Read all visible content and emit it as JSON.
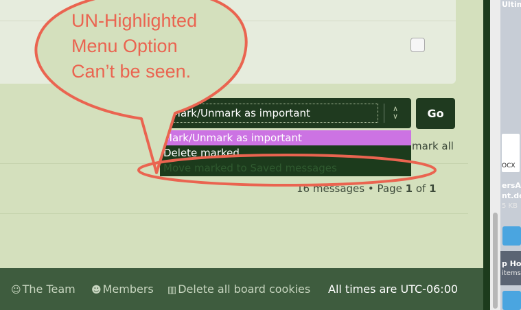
{
  "callout": {
    "line1": "UN-Highlighted",
    "line2": "Menu Option",
    "line3": "Can’t be seen.",
    "color": "#ea6450"
  },
  "actions": {
    "select_value": "Mark/Unmark as important",
    "go_label": "Go",
    "options": [
      "Mark/Unmark as important",
      "Delete marked",
      "Move marked to Saved messages"
    ],
    "highlight_color": "#cc73e3"
  },
  "mark_all": "mark all",
  "pagination": {
    "count_text": "16 messages",
    "bullet": "•",
    "page_word": "Page",
    "current": "1",
    "of_word": "of",
    "total": "1"
  },
  "footer": {
    "team": "The Team",
    "members": "Members",
    "delete_cookies": "Delete all board cookies",
    "timezone": "All times are UTC-06:00"
  },
  "desktop": {
    "top_label": "Ultim",
    "doc_ext": "OCX",
    "file_line1": "ersA",
    "file_line2": "nt.doc",
    "file_size": "5 KB",
    "folder_line1": "p Ho",
    "folder_line2": "items"
  }
}
